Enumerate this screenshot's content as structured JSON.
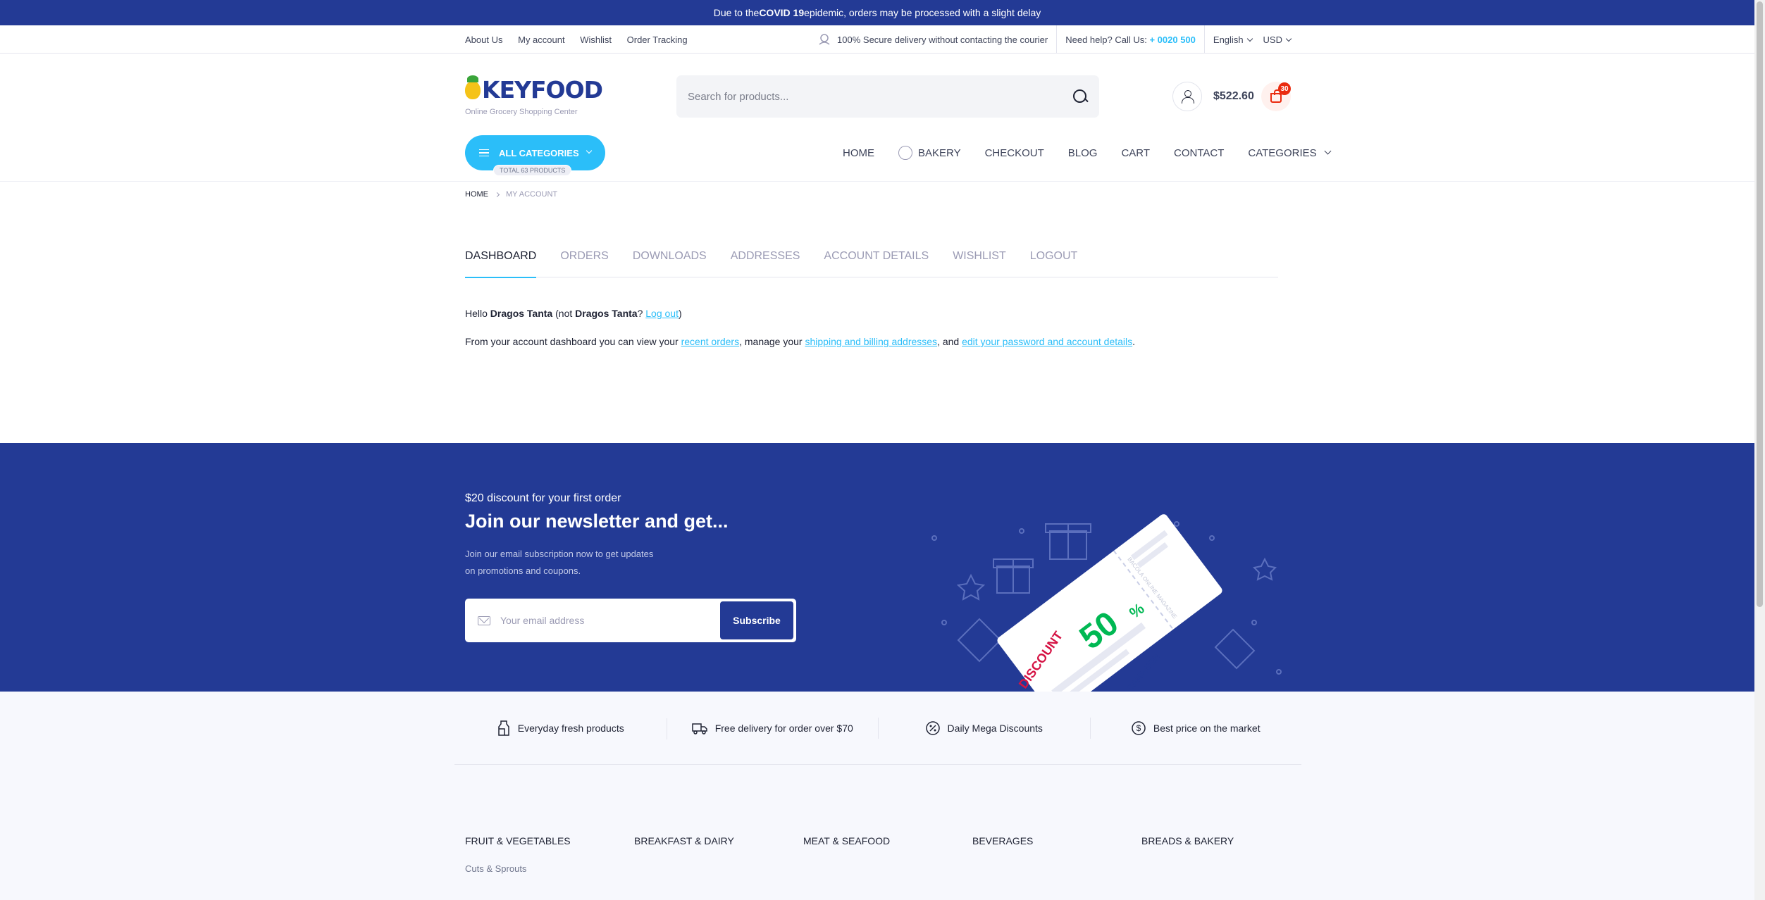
{
  "banner": {
    "prefix": "Due to the ",
    "bold": "COVID 19",
    "suffix": " epidemic, orders may be processed with a slight delay"
  },
  "topbar": {
    "links": [
      "About Us",
      "My account",
      "Wishlist",
      "Order Tracking"
    ],
    "secure": "100% Secure delivery without contacting the courier",
    "help_label": "Need help? Call Us: ",
    "phone": "+ 0020 500",
    "language": "English",
    "currency": "USD"
  },
  "header": {
    "brand": "KEYFOOD",
    "tagline": "Online Grocery Shopping Center",
    "search_placeholder": "Search for products...",
    "cart_total": "$522.60",
    "cart_count": "30"
  },
  "nav": {
    "all_categories": "ALL CATEGORIES",
    "total_products": "TOTAL 63 PRODUCTS",
    "items": [
      "HOME",
      "BAKERY",
      "CHECKOUT",
      "BLOG",
      "CART",
      "CONTACT",
      "CATEGORIES"
    ]
  },
  "breadcrumb": {
    "home": "HOME",
    "current": "MY ACCOUNT"
  },
  "tabs": [
    "DASHBOARD",
    "ORDERS",
    "DOWNLOADS",
    "ADDRESSES",
    "ACCOUNT DETAILS",
    "WISHLIST",
    "LOGOUT"
  ],
  "dashboard": {
    "hello": "Hello ",
    "user": "Dragos Tanta",
    "not": " (not ",
    "user2": "Dragos Tanta",
    "q": "? ",
    "logout": "Log out",
    "close": ")",
    "desc_1": "From your account dashboard you can view your ",
    "link_orders": "recent orders",
    "desc_2": ", manage your ",
    "link_addresses": "shipping and billing addresses",
    "desc_3": ", and ",
    "link_password": "edit your password and account details",
    "desc_4": "."
  },
  "newsletter": {
    "sub": "$20 discount for your first order",
    "title": "Join our newsletter and get...",
    "desc_line1": "Join our email subscription now to get updates",
    "desc_line2": "on promotions and coupons.",
    "placeholder": "Your email address",
    "button": "Subscribe",
    "coupon_discount": "DISCOUNT",
    "coupon_percent": "50",
    "coupon_sign": "%",
    "coupon_campaign": "CAMPAIGN",
    "coupon_small": "BACOLA ONLINE MAGAZINE"
  },
  "features": [
    "Everyday fresh products",
    "Free delivery for order over $70",
    "Daily Mega Discounts",
    "Best price on the market"
  ],
  "footer": {
    "categories": [
      "FRUIT & VEGETABLES",
      "BREAKFAST & DAIRY",
      "MEAT & SEAFOOD",
      "BEVERAGES",
      "BREADS & BAKERY"
    ],
    "first_link": "Cuts & Sprouts"
  },
  "colors": {
    "primary": "#233a95",
    "accent": "#2bbef9",
    "badge": "#ea2b0f",
    "green": "#00b853"
  }
}
